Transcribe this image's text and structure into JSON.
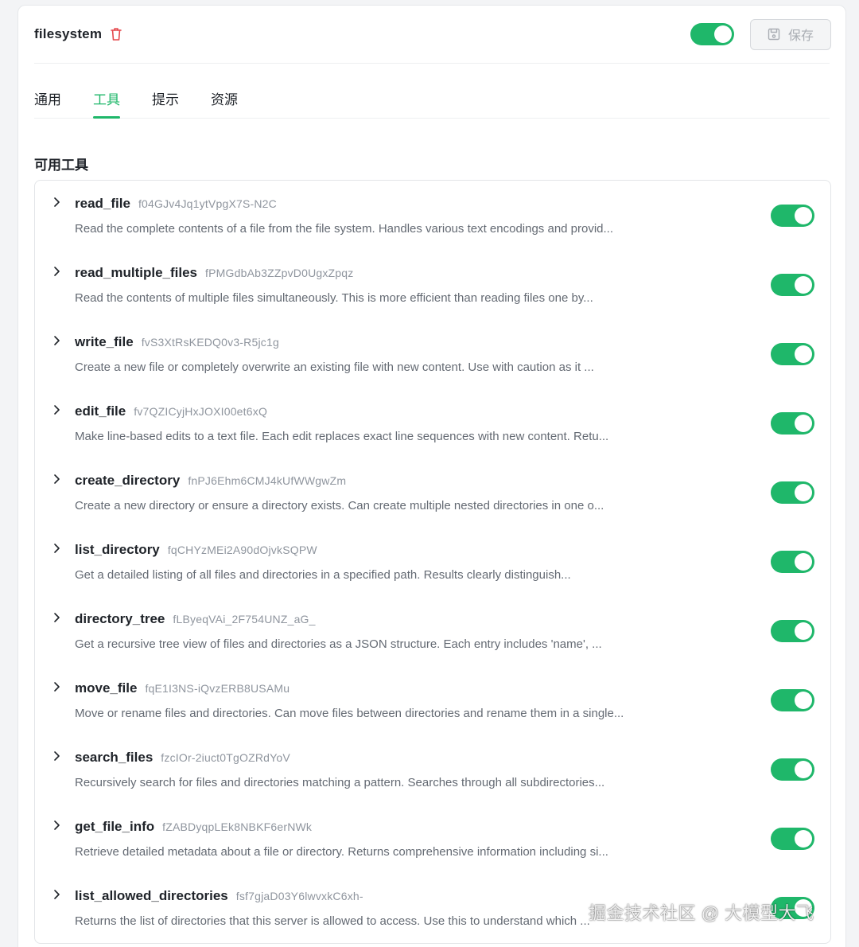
{
  "header": {
    "server_name": "filesystem",
    "enabled": true,
    "save_label": "保存"
  },
  "tabs": [
    {
      "label": "通用",
      "active": false
    },
    {
      "label": "工具",
      "active": true
    },
    {
      "label": "提示",
      "active": false
    },
    {
      "label": "资源",
      "active": false
    }
  ],
  "section_title": "可用工具",
  "colors": {
    "accent": "#1fb76a",
    "delete": "#e5484d"
  },
  "tools": [
    {
      "name": "read_file",
      "id": "f04GJv4Jq1ytVpgX7S-N2C",
      "description": "Read the complete contents of a file from the file system. Handles various text encodings and provid...",
      "enabled": true
    },
    {
      "name": "read_multiple_files",
      "id": "fPMGdbAb3ZZpvD0UgxZpqz",
      "description": "Read the contents of multiple files simultaneously. This is more efficient than reading files one by...",
      "enabled": true
    },
    {
      "name": "write_file",
      "id": "fvS3XtRsKEDQ0v3-R5jc1g",
      "description": "Create a new file or completely overwrite an existing file with new content. Use with caution as it ...",
      "enabled": true
    },
    {
      "name": "edit_file",
      "id": "fv7QZICyjHxJOXI00et6xQ",
      "description": "Make line-based edits to a text file. Each edit replaces exact line sequences with new content. Retu...",
      "enabled": true
    },
    {
      "name": "create_directory",
      "id": "fnPJ6Ehm6CMJ4kUfWWgwZm",
      "description": "Create a new directory or ensure a directory exists. Can create multiple nested directories in one o...",
      "enabled": true
    },
    {
      "name": "list_directory",
      "id": "fqCHYzMEi2A90dOjvkSQPW",
      "description": "Get a detailed listing of all files and directories in a specified path. Results clearly distinguish...",
      "enabled": true
    },
    {
      "name": "directory_tree",
      "id": "fLByeqVAi_2F754UNZ_aG_",
      "description": "Get a recursive tree view of files and directories as a JSON structure. Each entry includes 'name', ...",
      "enabled": true
    },
    {
      "name": "move_file",
      "id": "fqE1I3NS-iQvzERB8USAMu",
      "description": "Move or rename files and directories. Can move files between directories and rename them in a single...",
      "enabled": true
    },
    {
      "name": "search_files",
      "id": "fzcIOr-2iuct0TgOZRdYoV",
      "description": "Recursively search for files and directories matching a pattern. Searches through all subdirectories...",
      "enabled": true
    },
    {
      "name": "get_file_info",
      "id": "fZABDyqpLEk8NBKF6erNWk",
      "description": "Retrieve detailed metadata about a file or directory. Returns comprehensive information including si...",
      "enabled": true
    },
    {
      "name": "list_allowed_directories",
      "id": "fsf7gjaD03Y6lwvxkC6xh-",
      "description": "Returns the list of directories that this server is allowed to access. Use this to understand which ...",
      "enabled": true
    }
  ],
  "watermark": "掘金技术社区 @ 大模型大飞"
}
